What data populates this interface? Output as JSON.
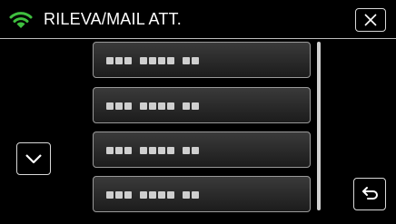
{
  "header": {
    "title": "RILEVA/MAIL ATT.",
    "wifi_icon": "wifi-icon",
    "wifi_color": "#3fbf3f",
    "close_icon": "close-icon"
  },
  "list": {
    "items": [
      {
        "masked_value": "masked-address"
      },
      {
        "masked_value": "masked-address"
      },
      {
        "masked_value": "masked-address"
      },
      {
        "masked_value": "masked-address"
      }
    ]
  },
  "controls": {
    "scroll_down_icon": "chevron-down-icon",
    "back_icon": "return-arrow-icon"
  },
  "colors": {
    "background": "#000000",
    "item_border": "#9a9a9a",
    "button_border": "#d8d8d8"
  }
}
